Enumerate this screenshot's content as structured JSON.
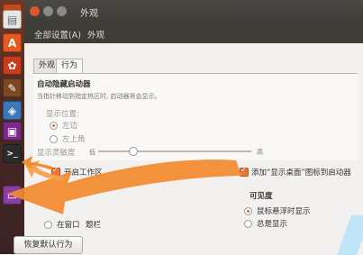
{
  "window": {
    "title": "外观"
  },
  "menu": {
    "all_settings": "全部设置(A)",
    "appearance": "外观"
  },
  "tabs": {
    "appearance": "外观",
    "behavior": "行为"
  },
  "autohide": {
    "title": "自动隐藏启动器",
    "desc": "当指针移动到指定热区时, 启动器将会显示。",
    "position_label": "显示位置:",
    "left": "左边",
    "top_left": "左上角",
    "sensitivity_label": "显示灵敏度",
    "low": "低",
    "high": "高"
  },
  "workspaces": {
    "label": "开启工作区",
    "checked": true
  },
  "show_desktop": {
    "label": "添加“显示桌面”图标到启动器",
    "checked": true
  },
  "menus_location": {
    "option2": "在窗口",
    "option2_suffix": "题栏"
  },
  "menu_visibility": {
    "title": "可见度",
    "on_hover": "鼠标悬浮时显示",
    "always": "总是显示"
  },
  "restore_button": "恢复默认行为",
  "colors": {
    "accent": "#e8743b",
    "arrow": "#f28a2e",
    "titlebar": "#3d3c37"
  }
}
